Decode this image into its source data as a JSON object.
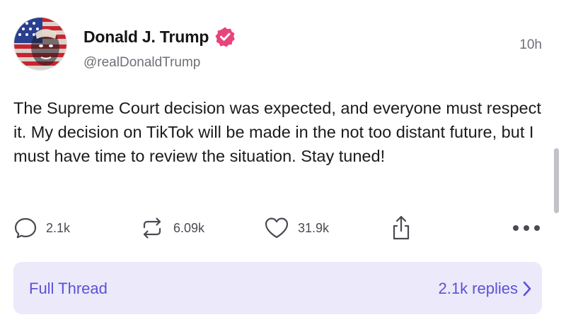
{
  "post": {
    "author": {
      "display_name": "Donald J. Trump",
      "handle": "@realDonaldTrump",
      "avatar": "avatar-image",
      "verified_icon": "verified-badge-icon"
    },
    "timestamp": "10h",
    "text": "The Supreme Court decision was expected, and everyone must respect it. My decision on TikTok will be made in the not too distant future, but I must have time to review the situation. Stay tuned!",
    "actions": {
      "replies": "2.1k",
      "reposts": "6.09k",
      "likes": "31.9k"
    }
  },
  "thread": {
    "label": "Full Thread",
    "replies": "2.1k replies"
  },
  "colors": {
    "accent": "#5b52d6",
    "thread_background": "#ece9fb",
    "verified": "#e8437a",
    "text": "#1b1b1d",
    "muted": "#6f6f78"
  }
}
